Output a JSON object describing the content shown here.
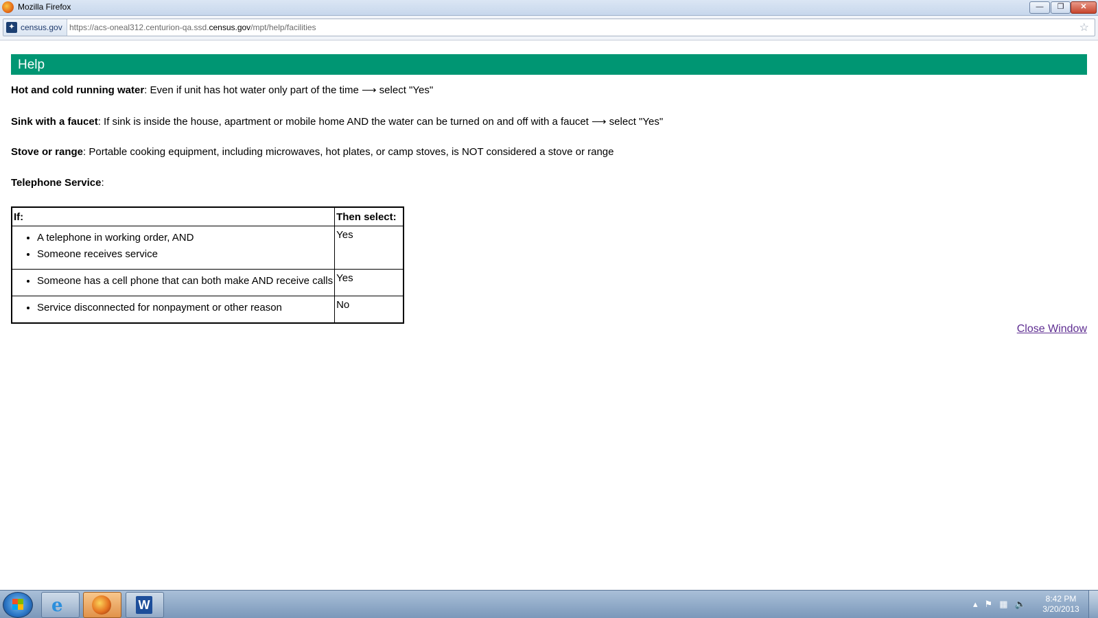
{
  "window": {
    "title": "Mozilla Firefox",
    "minimize_label": "—",
    "maximize_label": "❐",
    "close_label": "✕"
  },
  "address_bar": {
    "site_identity": "census.gov",
    "url_prefix": "https://acs-oneal312.centurion-qa.ssd.",
    "url_domain": "census.gov",
    "url_path": "/mpt/help/facilities"
  },
  "page": {
    "header": "Help",
    "items": [
      {
        "term": "Hot and cold running water",
        "text": ": Even if unit has hot water only part of the time ⟶ select \"Yes\""
      },
      {
        "term": "Sink with a faucet",
        "text": ": If sink is inside the house, apartment or mobile home AND the water can be turned on and off with a faucet ⟶ select \"Yes\""
      },
      {
        "term": "Stove or range",
        "text": ": Portable cooking equipment, including microwaves, hot plates, or camp stoves, is NOT considered a stove or range"
      },
      {
        "term": "Telephone Service",
        "text": ":"
      }
    ],
    "table": {
      "col_if": "If:",
      "col_then": "Then select:",
      "rows": [
        {
          "bullets": [
            "A telephone in working order, AND",
            "Someone receives service"
          ],
          "answer": "Yes"
        },
        {
          "bullets": [
            "Someone has a cell phone that can both make AND receive calls"
          ],
          "answer": "Yes"
        },
        {
          "bullets": [
            "Service disconnected for nonpayment or other reason"
          ],
          "answer": "No"
        }
      ]
    },
    "close_link": "Close Window"
  },
  "taskbar": {
    "clock_time": "8:42 PM",
    "clock_date": "3/20/2013",
    "apps": [
      "internet-explorer",
      "firefox",
      "microsoft-word"
    ],
    "word_letter": "W",
    "ie_letter": "e"
  },
  "colors": {
    "header_bg": "#009673",
    "link": "#5e2d91"
  }
}
